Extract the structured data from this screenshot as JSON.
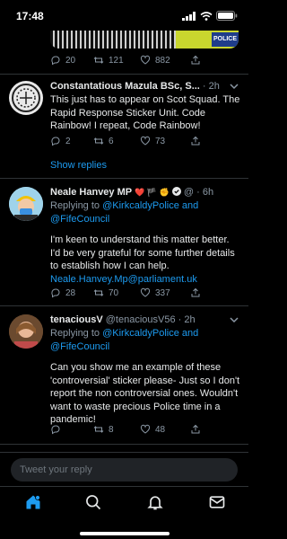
{
  "status_bar": {
    "time": "17:48"
  },
  "colors": {
    "accent": "#1d9bf0",
    "background": "#000000",
    "secondary_text": "#8b98a5",
    "divider": "#2f3336"
  },
  "top_tweet": {
    "replies": "20",
    "retweets": "121",
    "likes": "882",
    "media_label": "POLICE"
  },
  "tweets": [
    {
      "name": "Constantatious Mazula BSc, S...",
      "dot": "·",
      "time": "2h",
      "text": "This just has to appear on Scot Squad. The Rapid  Response Sticker Unit. Code Rainbow! I repeat, Code Rainbow!",
      "replies": "2",
      "retweets": "6",
      "likes": "73"
    },
    {
      "name": "Neale Hanvey MP",
      "name_emojis": "❤️ 🏴 ✊",
      "handle": "@",
      "dot": "·",
      "time": "6h",
      "replying_prefix": "Replying to ",
      "replying_to": "@KirkcaldyPolice and @FifeCouncil",
      "text": "I'm keen to understand this matter better. I'd be very grateful for some further details to establish how I can help. ",
      "text_link": "Neale.Hanvey.Mp@parliament.uk",
      "replies": "28",
      "retweets": "70",
      "likes": "337"
    },
    {
      "name": "tenaciousV",
      "handle": "@tenaciousV56",
      "dot": "·",
      "time": "2h",
      "replying_prefix": "Replying to ",
      "replying_to": "@KirkcaldyPolice and @FifeCouncil",
      "text": "Can you show me an example of these 'controversial' sticker please- Just so I don't report the non controversial ones. Wouldn't want to waste precious Police time in a pandemic!",
      "replies": "",
      "retweets": "8",
      "likes": "48"
    }
  ],
  "show_replies": "Show replies",
  "reply_bar": {
    "placeholder": "Tweet your reply"
  },
  "tab_bar": {
    "items": [
      "home-icon",
      "search-icon",
      "notifications-icon",
      "messages-icon"
    ]
  }
}
